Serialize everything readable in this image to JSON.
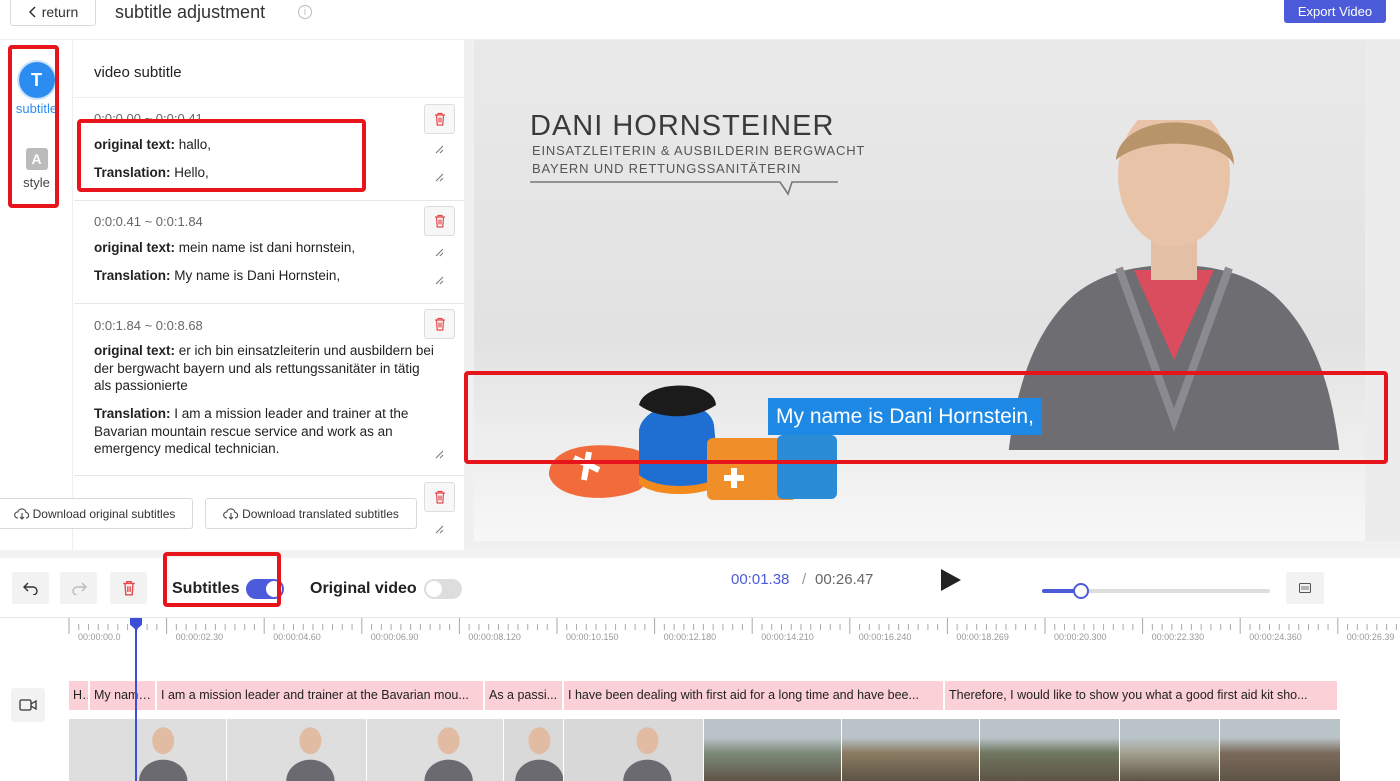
{
  "header": {
    "return_label": "return",
    "title": "subtitle adjustment",
    "info_glyph": "i",
    "export_label": "Export Video"
  },
  "rail": {
    "subtitle": {
      "icon_letter": "T",
      "label": "subtitle",
      "icon": "text-icon"
    },
    "style": {
      "icon_letter": "A",
      "label": "style",
      "icon": "font-style-icon"
    }
  },
  "subtitle_list": {
    "title": "video subtitle",
    "original_label": "original text:",
    "translation_label": "Translation:",
    "items": [
      {
        "time": "0:0:0.00 ~ 0:0:0.41",
        "original": "hallo,",
        "translation": "Hello,"
      },
      {
        "time": "0:0:0.41 ~ 0:0:1.84",
        "original": "mein name ist dani hornstein,",
        "translation": "My name is Dani Hornstein,"
      },
      {
        "time": "0:0:1.84 ~ 0:0:8.68",
        "original": "er ich bin einsatzleiterin und ausbildern bei der bergwacht bayern und als rettungssanitäter in tätig als passionierte",
        "translation": "I am a mission leader and trainer at the Bavarian mountain rescue service and work as an emergency medical technician."
      }
    ],
    "download_original": "Download original subtitles",
    "download_translated": "Download translated subtitles"
  },
  "video": {
    "lower_third_name": "DANI HORNSTEINER",
    "lower_third_line1": "EINSATZLEITERIN & AUSBILDERIN BERGWACHT",
    "lower_third_line2": "BAYERN UND RETTUNGSSANITÄTERIN",
    "caption": "My name is Dani Hornstein,"
  },
  "toolbar": {
    "subtitles_label": "Subtitles",
    "subtitles_on": true,
    "original_video_label": "Original video",
    "original_video_on": false,
    "current_time": "00:01.38",
    "time_separator": "/",
    "total_time": "00:26.47",
    "zoom_level": 0.17,
    "icons": [
      "undo-icon",
      "redo-icon",
      "trash-icon",
      "play-icon",
      "fit-icon"
    ]
  },
  "timeline": {
    "ticks": [
      "00:00:00.0",
      "00:00:02.30",
      "00:00:04.60",
      "00:00:06.90",
      "00:00:08.120",
      "00:00:10.150",
      "00:00:12.180",
      "00:00:14.210",
      "00:00:16.240",
      "00:00:18.269",
      "00:00:20.300",
      "00:00:22.330",
      "00:00:24.360",
      "00:00:26.39"
    ],
    "segments": [
      "H...",
      "My name...",
      "I am a mission leader and trainer at the Bavarian mou...",
      "As a passi...",
      "I have been dealing with first aid for a long time and have bee...",
      "Therefore, I would like to show you what a good first aid kit sho..."
    ]
  },
  "colors": {
    "accent": "#4b5bd9",
    "caption_bg": "#1e88e5",
    "subtitle_track": "#fbd0d6",
    "highlight_box": "#e8141b",
    "delete_icon": "#e5484d"
  }
}
